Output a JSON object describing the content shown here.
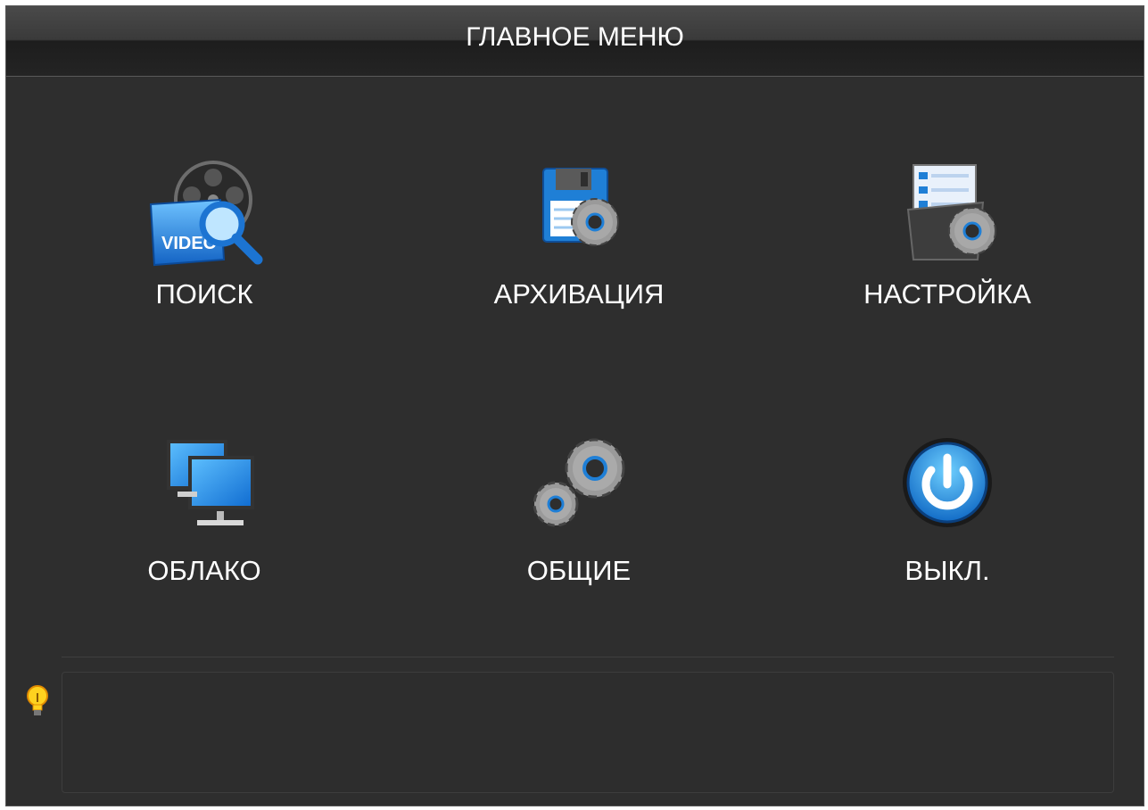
{
  "window": {
    "title": "ГЛАВНОЕ МЕНЮ"
  },
  "menu": {
    "items": [
      {
        "label": "ПОИСК",
        "icon": "video-search-icon"
      },
      {
        "label": "АРХИВАЦИЯ",
        "icon": "backup-floppy-gear-icon"
      },
      {
        "label": "НАСТРОЙКА",
        "icon": "settings-folder-gear-icon"
      },
      {
        "label": "ОБЛАКО",
        "icon": "network-monitors-icon"
      },
      {
        "label": "ОБЩИЕ",
        "icon": "gears-icon"
      },
      {
        "label": "ВЫКЛ.",
        "icon": "power-icon"
      }
    ]
  },
  "hint": {
    "icon": "lightbulb-icon",
    "text": ""
  },
  "colors": {
    "background": "#2e2e2e",
    "text": "#ffffff",
    "accent_blue": "#1f8fe6",
    "gear_gray": "#9a9a9a"
  }
}
